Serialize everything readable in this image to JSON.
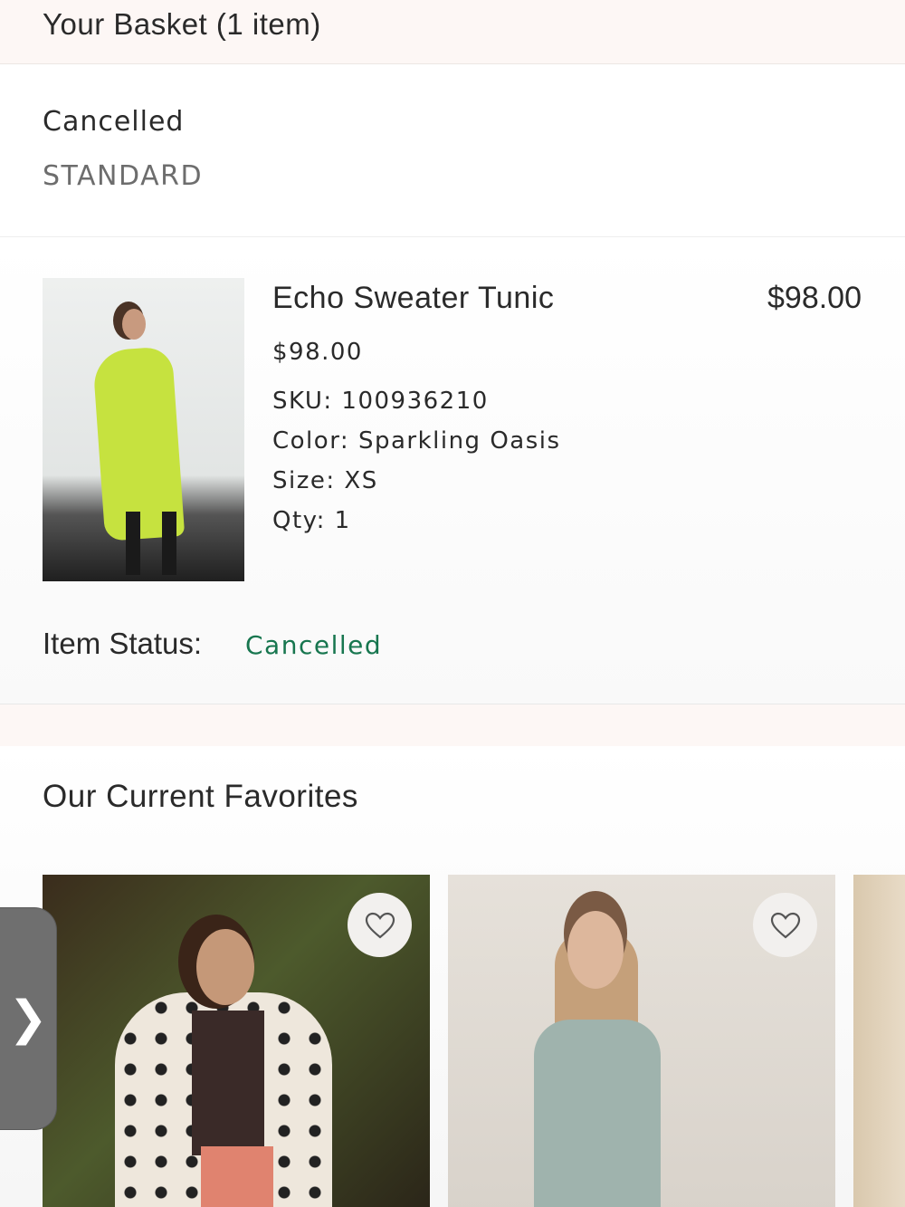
{
  "header": {
    "title": "Your Basket (1 item)"
  },
  "shipment": {
    "status": "Cancelled",
    "method": "STANDARD"
  },
  "item": {
    "name": "Echo Sweater Tunic",
    "total": "$98.00",
    "price": "$98.00",
    "sku": "SKU: 100936210",
    "color": "Color: Sparkling Oasis",
    "size": "Size: XS",
    "qty": "Qty: 1",
    "status_label": "Item Status:",
    "status_value": "Cancelled",
    "status_color": "#17764f"
  },
  "favorites": {
    "heading": "Our Current Favorites",
    "icon": "heart-icon"
  },
  "side_tab": {
    "glyph": "❯"
  }
}
